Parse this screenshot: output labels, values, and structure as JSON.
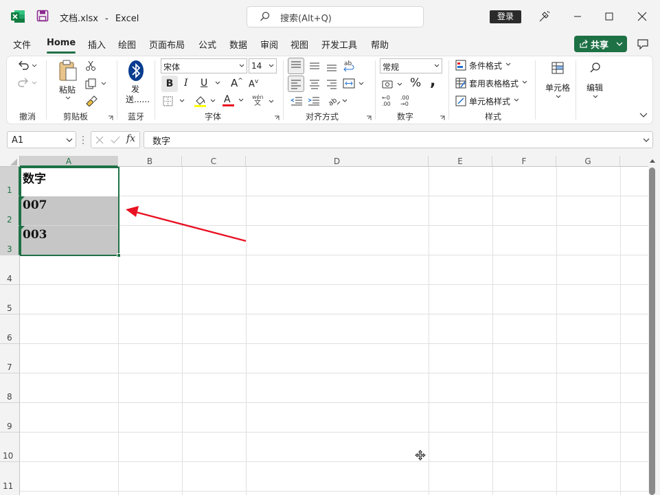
{
  "app": {
    "file_title": "文档.xlsx",
    "separator": "-",
    "app_name": "Excel",
    "search_placeholder": "搜索(Alt+Q)",
    "login_label": "登录"
  },
  "menu": {
    "items": [
      "文件",
      "Home",
      "插入",
      "绘图",
      "页面布局",
      "公式",
      "数据",
      "审阅",
      "视图",
      "开发工具",
      "帮助"
    ],
    "active": "Home",
    "share_label": "共享"
  },
  "ribbon": {
    "undo_group": "撤消",
    "clipboard": {
      "paste_label": "粘贴",
      "group": "剪贴板"
    },
    "bluetooth": {
      "send_label_1": "发",
      "send_label_2": "送......",
      "group": "蓝牙"
    },
    "font": {
      "name": "宋体",
      "size": "14",
      "bold": "B",
      "italic": "I",
      "underline": "U",
      "grow": "A",
      "shrink": "A",
      "group": "字体",
      "phonetic_top": "wén",
      "phonetic_bottom": "文",
      "highlight_color": "#ffff00",
      "font_color": "#e81123"
    },
    "alignment": {
      "group": "对齐方式"
    },
    "number": {
      "format": "常规",
      "percent": "%",
      "comma": ",",
      "group": "数字",
      "increase_decimal_top": "←0",
      "increase_decimal_bottom": ".00",
      "decrease_decimal_top": ".00",
      "decrease_decimal_bottom": "→0"
    },
    "styles": {
      "conditional": "条件格式",
      "table": "套用表格格式",
      "cell": "单元格样式",
      "group": "样式"
    },
    "cells": {
      "label": "单元格"
    },
    "editing": {
      "label": "编辑"
    }
  },
  "formula_bar": {
    "name_box": "A1",
    "fx": "fx",
    "content": "数字"
  },
  "sheet": {
    "columns": [
      "A",
      "B",
      "C",
      "D",
      "E",
      "F",
      "G"
    ],
    "rows": [
      "1",
      "2",
      "3",
      "4",
      "5",
      "6",
      "7",
      "8",
      "9",
      "10",
      "11"
    ],
    "cells": {
      "A1": "数字",
      "A2": "007",
      "A3": "003"
    },
    "selection": "A1:A3",
    "accent_color": "#1e7145",
    "arrow_color": "#e81123"
  }
}
